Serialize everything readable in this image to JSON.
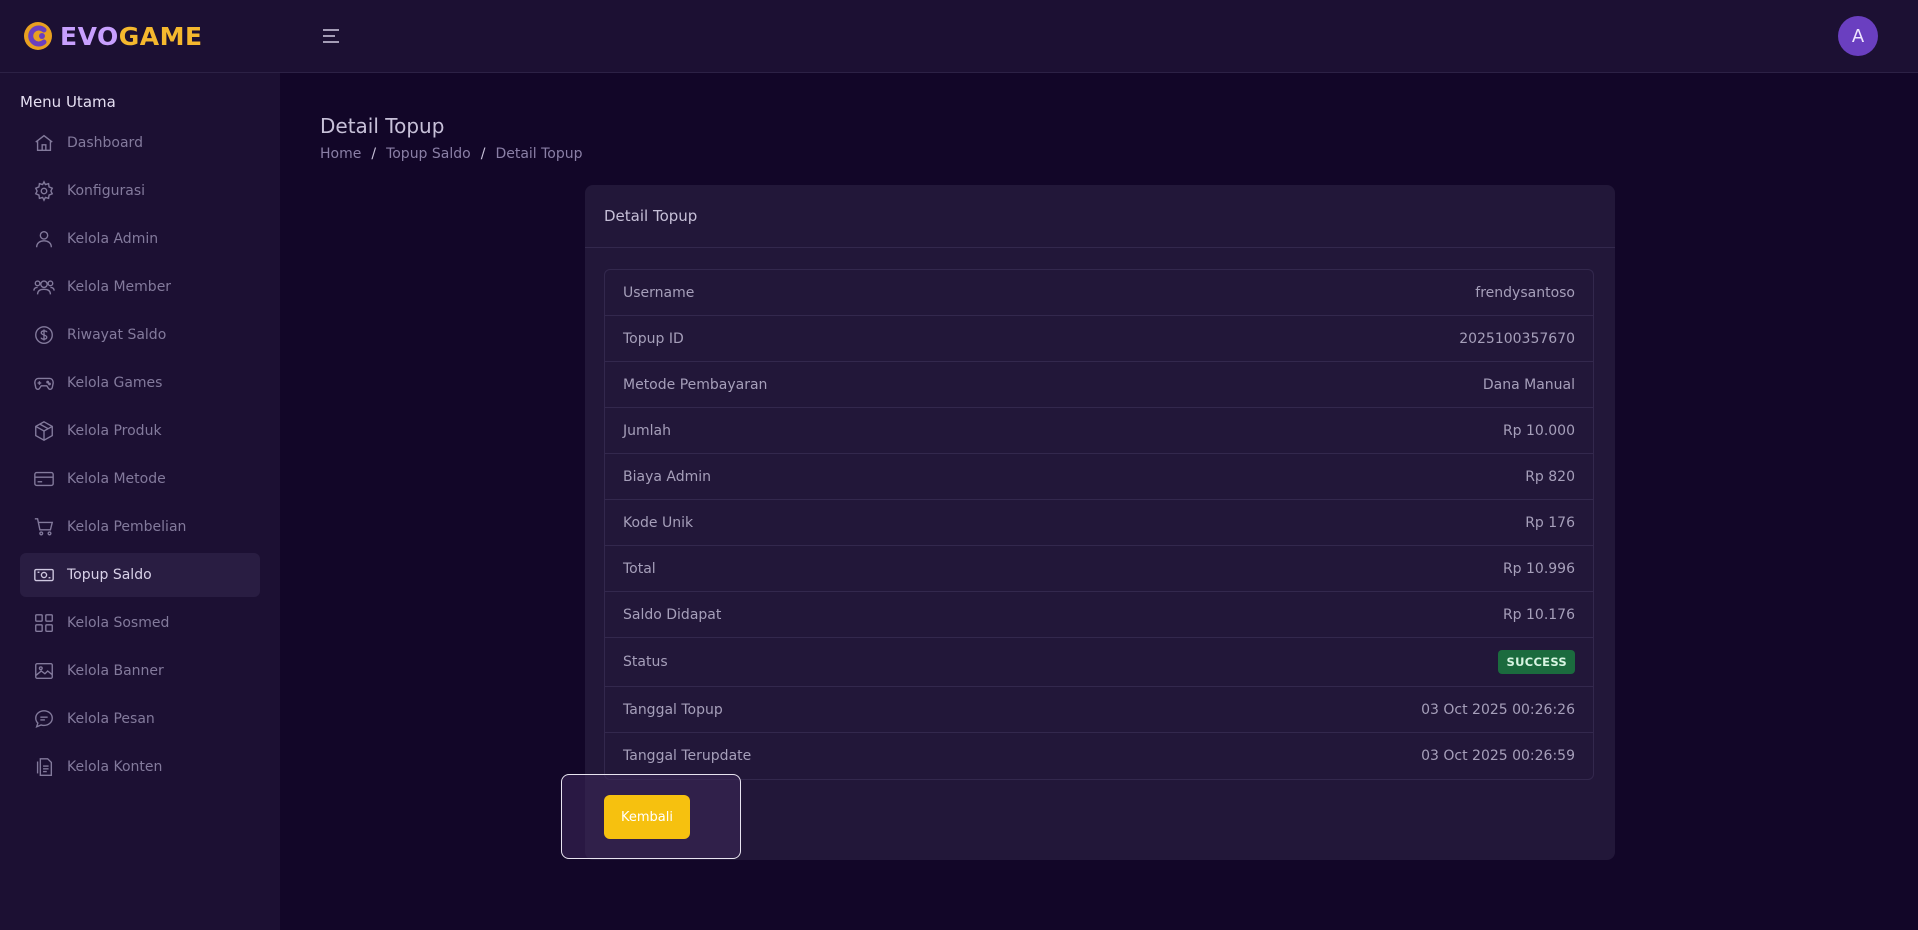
{
  "brand": {
    "part1": "EVO",
    "part2": "GAME"
  },
  "user": {
    "avatar_initial": "A"
  },
  "sidebar": {
    "title": "Menu Utama",
    "items": [
      {
        "label": "Dashboard",
        "icon": "home-icon"
      },
      {
        "label": "Konfigurasi",
        "icon": "gear-icon"
      },
      {
        "label": "Kelola Admin",
        "icon": "user-icon"
      },
      {
        "label": "Kelola Member",
        "icon": "users-icon"
      },
      {
        "label": "Riwayat Saldo",
        "icon": "dollar-icon"
      },
      {
        "label": "Kelola Games",
        "icon": "gamepad-icon"
      },
      {
        "label": "Kelola Produk",
        "icon": "box-icon"
      },
      {
        "label": "Kelola Metode",
        "icon": "card-icon"
      },
      {
        "label": "Kelola Pembelian",
        "icon": "cart-icon"
      },
      {
        "label": "Topup Saldo",
        "icon": "cash-icon"
      },
      {
        "label": "Kelola Sosmed",
        "icon": "grid-icon"
      },
      {
        "label": "Kelola Banner",
        "icon": "image-icon"
      },
      {
        "label": "Kelola Pesan",
        "icon": "chat-icon"
      },
      {
        "label": "Kelola Konten",
        "icon": "document-icon"
      }
    ]
  },
  "page": {
    "title": "Detail Topup",
    "breadcrumb": [
      "Home",
      "Topup Saldo",
      "Detail Topup"
    ]
  },
  "card": {
    "title": "Detail Topup",
    "rows": [
      {
        "label": "Username",
        "value": "frendysantoso"
      },
      {
        "label": "Topup ID",
        "value": "2025100357670"
      },
      {
        "label": "Metode Pembayaran",
        "value": "Dana Manual"
      },
      {
        "label": "Jumlah",
        "value": "Rp 10.000"
      },
      {
        "label": "Biaya Admin",
        "value": "Rp 820"
      },
      {
        "label": "Kode Unik",
        "value": "Rp 176"
      },
      {
        "label": "Total",
        "value": "Rp 10.996"
      },
      {
        "label": "Saldo Didapat",
        "value": "Rp 10.176"
      },
      {
        "label": "Status",
        "value": "SUCCESS",
        "badge": true,
        "badge_color": "#1b6b3e"
      },
      {
        "label": "Tanggal Topup",
        "value": "03 Oct 2025 00:26:26"
      },
      {
        "label": "Tanggal Terupdate",
        "value": "03 Oct 2025 00:26:59"
      }
    ],
    "back_label": "Kembali"
  },
  "colors": {
    "accent": "#f6c10f",
    "background": "#120628",
    "panel": "#1c1033",
    "success": "#1b6b3e"
  }
}
